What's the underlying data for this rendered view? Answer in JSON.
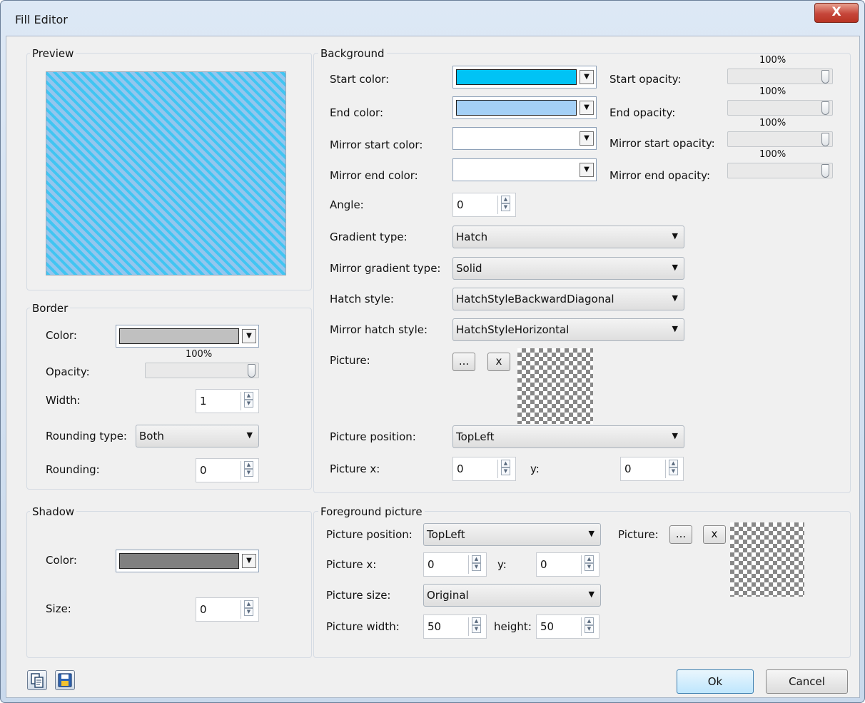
{
  "window": {
    "title": "Fill Editor",
    "close_label": "X"
  },
  "preview": {
    "title": "Preview"
  },
  "background": {
    "title": "Background",
    "start_color_label": "Start color:",
    "start_color": "#00c3f5",
    "end_color_label": "End color:",
    "end_color": "#a4d0f6",
    "mirror_start_color_label": "Mirror start color:",
    "mirror_start_color": "#ffffff",
    "mirror_end_color_label": "Mirror end color:",
    "mirror_end_color": "#ffffff",
    "start_opacity_label": "Start opacity:",
    "start_opacity": "100%",
    "end_opacity_label": "End opacity:",
    "end_opacity": "100%",
    "mirror_start_opacity_label": "Mirror start opacity:",
    "mirror_start_opacity": "100%",
    "mirror_end_opacity_label": "Mirror end opacity:",
    "mirror_end_opacity": "100%",
    "angle_label": "Angle:",
    "angle": "0",
    "gradient_type_label": "Gradient type:",
    "gradient_type": "Hatch",
    "mirror_gradient_type_label": "Mirror gradient type:",
    "mirror_gradient_type": "Solid",
    "hatch_style_label": "Hatch style:",
    "hatch_style": "HatchStyleBackwardDiagonal",
    "mirror_hatch_style_label": "Mirror hatch style:",
    "mirror_hatch_style": "HatchStyleHorizontal",
    "picture_label": "Picture:",
    "browse_label": "...",
    "clear_label": "x",
    "picture_position_label": "Picture position:",
    "picture_position": "TopLeft",
    "picture_x_label": "Picture x:",
    "picture_x": "0",
    "y_label": "y:",
    "picture_y": "0"
  },
  "border": {
    "title": "Border",
    "color_label": "Color:",
    "color": "#c0c0c0",
    "opacity_label": "Opacity:",
    "opacity": "100%",
    "width_label": "Width:",
    "width": "1",
    "rounding_type_label": "Rounding type:",
    "rounding_type": "Both",
    "rounding_label": "Rounding:",
    "rounding": "0"
  },
  "shadow": {
    "title": "Shadow",
    "color_label": "Color:",
    "color": "#808080",
    "size_label": "Size:",
    "size": "0"
  },
  "foreground": {
    "title": "Foreground picture",
    "picture_position_label": "Picture position:",
    "picture_position": "TopLeft",
    "picture_label": "Picture:",
    "browse_label": "...",
    "clear_label": "x",
    "picture_x_label": "Picture x:",
    "picture_x": "0",
    "y_label": "y:",
    "picture_y": "0",
    "picture_size_label": "Picture size:",
    "picture_size": "Original",
    "picture_width_label": "Picture width:",
    "picture_width": "50",
    "height_label": "height:",
    "picture_height": "50"
  },
  "footer": {
    "ok_label": "Ok",
    "cancel_label": "Cancel"
  }
}
